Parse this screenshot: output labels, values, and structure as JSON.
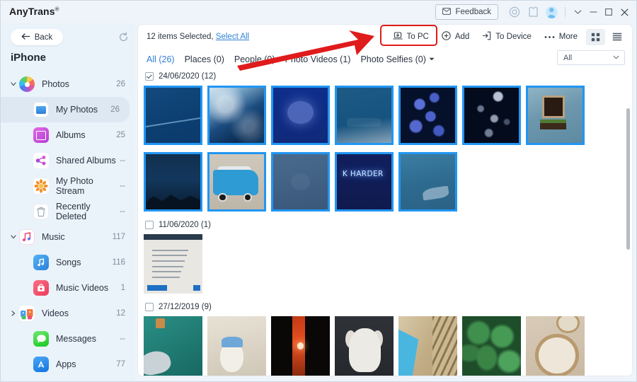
{
  "titlebar": {
    "brand": "AnyTrans",
    "brand_mark": "®",
    "feedback_label": "Feedback",
    "icons": [
      "mail-icon",
      "search-icon",
      "shirt-icon",
      "avatar-icon"
    ],
    "window_controls": [
      "chevron-down-icon",
      "minimize-icon",
      "maximize-icon",
      "close-icon"
    ]
  },
  "sidebar": {
    "back_label": "Back",
    "device_name": "iPhone",
    "refresh_icon": "refresh-icon",
    "items": [
      {
        "label": "Photos",
        "count": "26",
        "level": "parent",
        "caret": "down",
        "icon": "ic-photos",
        "selected": false
      },
      {
        "label": "My Photos",
        "count": "26",
        "level": "child",
        "caret": "none",
        "icon": "ic-myphotos",
        "selected": true
      },
      {
        "label": "Albums",
        "count": "25",
        "level": "child",
        "caret": "none",
        "icon": "ic-albums",
        "selected": false
      },
      {
        "label": "Shared Albums",
        "count": "--",
        "level": "child",
        "caret": "none",
        "icon": "ic-shared",
        "selected": false
      },
      {
        "label": "My Photo Stream",
        "count": "--",
        "level": "child",
        "caret": "none",
        "icon": "ic-stream",
        "selected": false
      },
      {
        "label": "Recently Deleted",
        "count": "--",
        "level": "child",
        "caret": "none",
        "icon": "ic-trash",
        "selected": false
      },
      {
        "label": "Music",
        "count": "117",
        "level": "parent",
        "caret": "down",
        "icon": "ic-music",
        "selected": false
      },
      {
        "label": "Songs",
        "count": "116",
        "level": "child",
        "caret": "none",
        "icon": "ic-songs",
        "selected": false
      },
      {
        "label": "Music Videos",
        "count": "1",
        "level": "child",
        "caret": "none",
        "icon": "ic-musicvid",
        "selected": false
      },
      {
        "label": "Videos",
        "count": "12",
        "level": "parent",
        "caret": "right",
        "icon": "ic-videos",
        "selected": false
      },
      {
        "label": "Messages",
        "count": "--",
        "level": "child",
        "caret": "none",
        "icon": "ic-messages",
        "selected": false
      },
      {
        "label": "Apps",
        "count": "77",
        "level": "child",
        "caret": "none",
        "icon": "ic-apps",
        "selected": false
      }
    ]
  },
  "toolbar": {
    "selection_text": "12 items Selected,",
    "select_all_label": "Select All",
    "to_pc_label": "To PC",
    "to_pc_icon": "to-pc-icon",
    "add_label": "Add",
    "add_icon": "plus-circle-icon",
    "to_device_label": "To Device",
    "to_device_icon": "to-device-icon",
    "more_label": "More",
    "more_icon": "ellipsis-icon",
    "grid_view_icon": "grid-view-icon",
    "list_view_icon": "list-view-icon",
    "highlight_color": "#e01b1b"
  },
  "tabs": [
    {
      "label": "All (26)",
      "active": true,
      "caret": false
    },
    {
      "label": "Places (0)",
      "active": false,
      "caret": false
    },
    {
      "label": "People (0)",
      "active": false,
      "caret": false
    },
    {
      "label": "Photo Videos (1)",
      "active": false,
      "caret": false
    },
    {
      "label": "Photo Selfies (0)",
      "active": false,
      "caret": true
    }
  ],
  "filter": {
    "value": "All",
    "caret_icon": "chevron-down-icon"
  },
  "groups": [
    {
      "date": "24/06/2020 (12)",
      "checked": true,
      "photos": [
        {
          "name": "photo-deep-blue",
          "art": "t-deepblue",
          "selected": true
        },
        {
          "name": "photo-ocean-waves",
          "art": "t-waves",
          "selected": true
        },
        {
          "name": "photo-jellyfish",
          "art": "t-jelly",
          "selected": true
        },
        {
          "name": "photo-blue-flat",
          "art": "t-flat",
          "selected": true
        },
        {
          "name": "photo-coral",
          "art": "t-coral",
          "selected": true
        },
        {
          "name": "photo-jellyfish-group",
          "art": "t-jellies",
          "selected": true
        },
        {
          "name": "photo-wall-planter",
          "art": "t-wall",
          "selected": true
        },
        {
          "name": "photo-night-mountain",
          "art": "t-night",
          "selected": true
        },
        {
          "name": "photo-blue-van",
          "art": "t-truck",
          "selected": true
        },
        {
          "name": "photo-grey-blue",
          "art": "t-grey",
          "selected": true
        },
        {
          "name": "photo-neon-sign",
          "art": "t-neon",
          "selected": true,
          "overlay_text": "K HARDER"
        },
        {
          "name": "photo-ocean-surf",
          "art": "t-ocean",
          "selected": true
        }
      ]
    },
    {
      "date": "11/06/2020 (1)",
      "checked": false,
      "photos": [
        {
          "name": "photo-document-scan",
          "art": "t-doc",
          "selected": false
        }
      ]
    },
    {
      "date": "27/12/2019 (9)",
      "checked": false,
      "photos": [
        {
          "name": "photo-teal-car",
          "art": "t-car",
          "selected": false
        },
        {
          "name": "photo-snowman",
          "art": "t-snow",
          "selected": false
        },
        {
          "name": "photo-sunset-gap",
          "art": "t-sunset",
          "selected": false
        },
        {
          "name": "photo-white-dog",
          "art": "t-dog",
          "selected": false
        },
        {
          "name": "photo-stairs-pool",
          "art": "t-stairs",
          "selected": false
        },
        {
          "name": "photo-green-leaf",
          "art": "t-leaves",
          "selected": false
        },
        {
          "name": "photo-plate-cup",
          "art": "t-plate",
          "selected": false
        }
      ]
    }
  ]
}
